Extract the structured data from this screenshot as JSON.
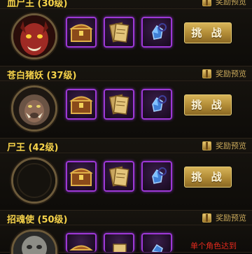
{
  "bosses": [
    {
      "name": "血尸王 (30级)",
      "preview": "奖励预览",
      "button": "挑 战"
    },
    {
      "name": "苍白猪妖 (37级)",
      "preview": "奖励预览",
      "button": "挑 战"
    },
    {
      "name": "尸王 (42级)",
      "preview": "奖励预览",
      "button": "挑 战"
    },
    {
      "name": "招魂使 (50级)",
      "preview": "奖励预览",
      "condition": "单个角色达到"
    }
  ],
  "reward_items": [
    "treasure-chest-icon",
    "scroll-bundle-icon",
    "blue-gem-icon"
  ],
  "colors": {
    "name": "#f6d34a",
    "slot_border": "#9d38d6",
    "button": "#c9a24a",
    "condition": "#e52a1e"
  }
}
